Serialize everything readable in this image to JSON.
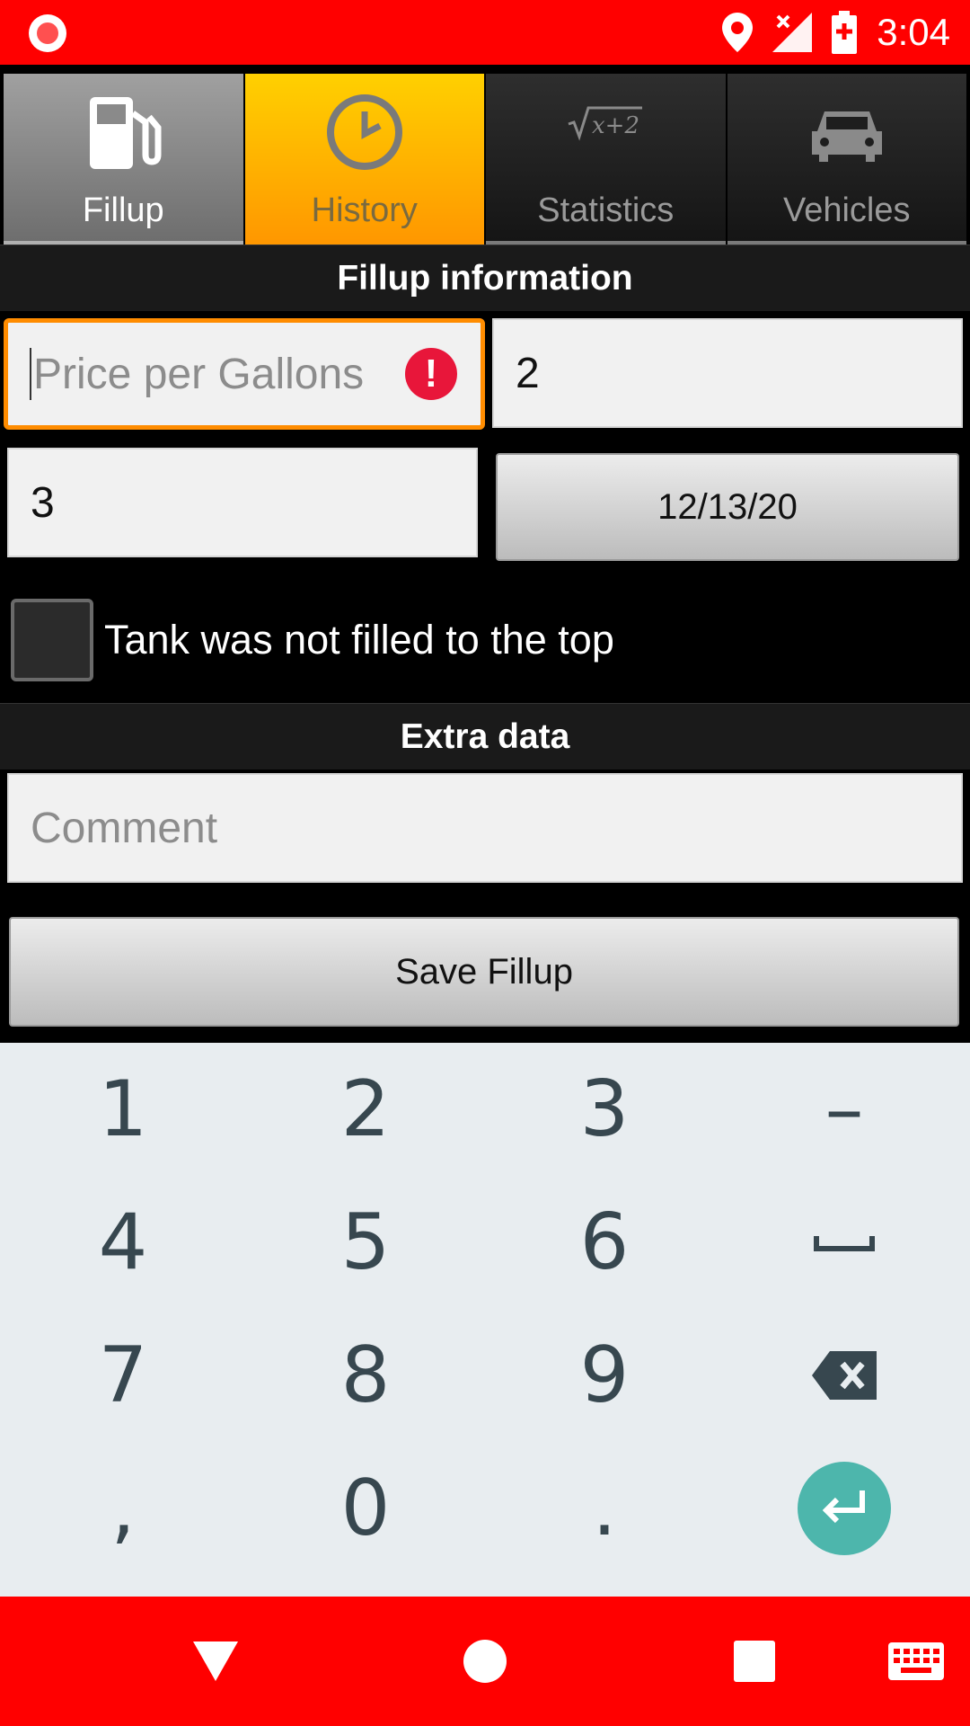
{
  "status_bar": {
    "time": "3:04",
    "icons": [
      "record-icon",
      "location-icon",
      "signal-off-icon",
      "battery-charging-icon"
    ],
    "color": "#ff0000"
  },
  "tabs": [
    {
      "label": "Fillup",
      "icon": "fuel-pump-icon",
      "state": "selected"
    },
    {
      "label": "History",
      "icon": "clock-icon",
      "state": "highlighted"
    },
    {
      "label": "Statistics",
      "icon": "formula-icon",
      "state": "normal"
    },
    {
      "label": "Vehicles",
      "icon": "car-icon",
      "state": "normal"
    }
  ],
  "fillup_section": {
    "title": "Fillup information",
    "price_placeholder": "Price per Gallons",
    "price_value": "",
    "quantity_value": "2",
    "odometer_value": "3",
    "date_button": "12/13/20",
    "partial_fill_label": "Tank was not filled to the top",
    "partial_fill_checked": false
  },
  "extra_section": {
    "title": "Extra data",
    "comment_placeholder": "Comment",
    "save_button": "Save Fillup"
  },
  "keypad": {
    "rows": [
      [
        "1",
        "2",
        "3",
        "–"
      ],
      [
        "4",
        "5",
        "6",
        "␣"
      ],
      [
        "7",
        "8",
        "9",
        "backspace"
      ],
      [
        ",",
        "0",
        ".",
        "enter"
      ]
    ],
    "row1": {
      "k1": "1",
      "k2": "2",
      "k3": "3",
      "k4": "–"
    },
    "row2": {
      "k1": "4",
      "k2": "5",
      "k3": "6"
    },
    "row3": {
      "k1": "7",
      "k2": "8",
      "k3": "9"
    },
    "row4": {
      "k1": ",",
      "k2": "0",
      "k3": "."
    },
    "accent": "#4db6ac"
  },
  "nav_bar": {
    "buttons": [
      "back-icon",
      "home-icon",
      "recents-icon",
      "keyboard-icon"
    ],
    "color": "#ff0000"
  },
  "colors": {
    "focus_border": "#ff8c00",
    "error": "#e8163a",
    "history_tab": "#ffb300"
  }
}
